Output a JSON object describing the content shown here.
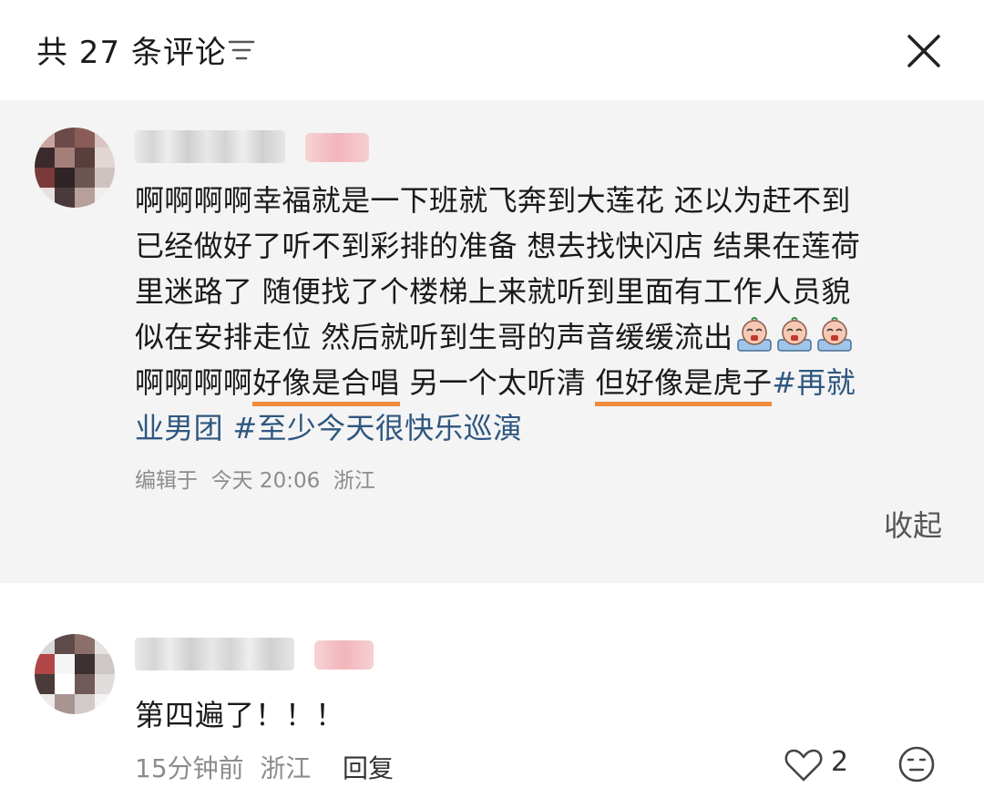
{
  "header": {
    "title": "共 27 条评论"
  },
  "comment1": {
    "text_lines": [
      "啊啊啊啊幸福就是一下班就飞奔到大莲花 还以为赶不到",
      "已经做好了听不到彩排的准备 想去找快闪店 结果在莲荷",
      "里迷路了 随便找了个楼梯上来就听到里面有工作人员貌",
      "似在安排走位 然后就听到生哥的声音缓缓流出"
    ],
    "line5_plain": "啊啊啊啊",
    "line5_underlined_a": "好像是合唱",
    "line5_mid": " 另一个太听清 ",
    "line5_underlined_b": "但好像是虎子",
    "tag1_start": "#再就",
    "tag1_end": "业男团",
    "tag2": "#至少今天很快乐巡演",
    "meta": "编辑于  今天 20:06  浙江",
    "collapse_label": "收起",
    "emoji_name": "crying-face-emoji"
  },
  "comment2": {
    "text": "第四遍了！！！",
    "meta": "15分钟前  浙江",
    "reply_label": "回复",
    "like_count": "2"
  },
  "colors": {
    "underline": "#f08a3a",
    "hashtag": "#2f5780",
    "background_highlight": "#f4f4f4"
  }
}
